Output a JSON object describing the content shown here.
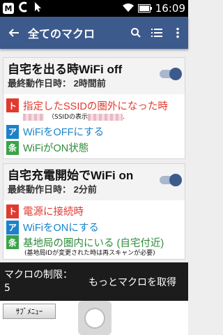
{
  "status_bar": {
    "time": "16:09",
    "icons": [
      "m-icon",
      "c-icon",
      "cursor-icon",
      "wifi-icon",
      "battery-icon"
    ]
  },
  "app_bar": {
    "title": "全てのマクロ",
    "icons": [
      "back-arrow-icon",
      "search-icon",
      "list-icon",
      "more-vert-icon"
    ]
  },
  "macros": [
    {
      "name": "自宅を出る時WiFi off",
      "last_run": "最終動作日時： 2時間前",
      "enabled": true,
      "trigger": {
        "badge": "ト",
        "text": "指定したSSIDの圏外になった時",
        "note": "（SSIDの表示",
        "note_end": "."
      },
      "action": {
        "badge": "ア",
        "text": "WiFiをOFFにする"
      },
      "condition": {
        "badge": "条",
        "text": "WiFiがON状態"
      }
    },
    {
      "name": "自宅充電開始でWiFi on",
      "last_run": "最終動作日時： 2分前",
      "enabled": true,
      "trigger": {
        "badge": "ト",
        "text": "電源に接続時"
      },
      "action": {
        "badge": "ア",
        "text": "WiFiをONにする"
      },
      "condition": {
        "badge": "条",
        "text": "基地局の圏内にいる (自宅付近)",
        "note": "(基地局IDが変更された時は再スキャンが必要)"
      }
    }
  ],
  "bottom_bar": {
    "limit_label": "マクロの制限： 5",
    "get_more": "もっとマクロを取得"
  },
  "nav": {
    "submenu": "ｻﾌﾞﾒﾆｭｰ"
  },
  "colors": {
    "app_bar": "#3d5a8c",
    "trigger": "#e03a2f",
    "action": "#1b82c9",
    "condition": "#3aa348"
  }
}
